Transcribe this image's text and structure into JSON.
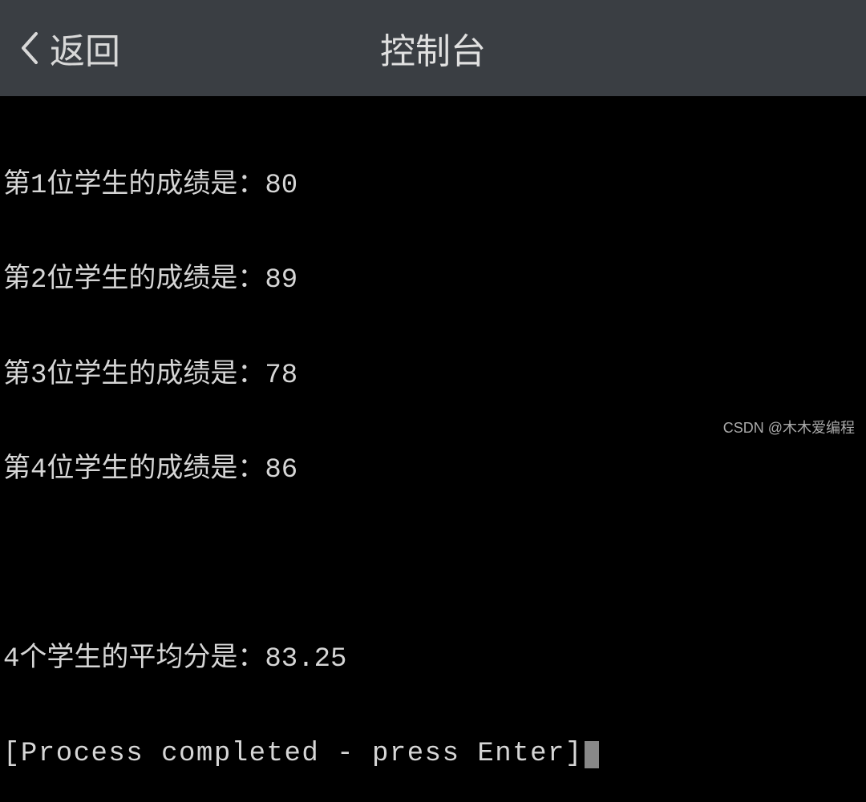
{
  "header": {
    "back_label": "返回",
    "title": "控制台"
  },
  "console": {
    "lines": [
      "第1位学生的成绩是：80",
      "第2位学生的成绩是：89",
      "第3位学生的成绩是：78",
      "第4位学生的成绩是：86"
    ],
    "average_line": "4个学生的平均分是：83.25",
    "process_line": "[Process completed - press Enter]"
  },
  "watermark": "CSDN @木木爱编程"
}
